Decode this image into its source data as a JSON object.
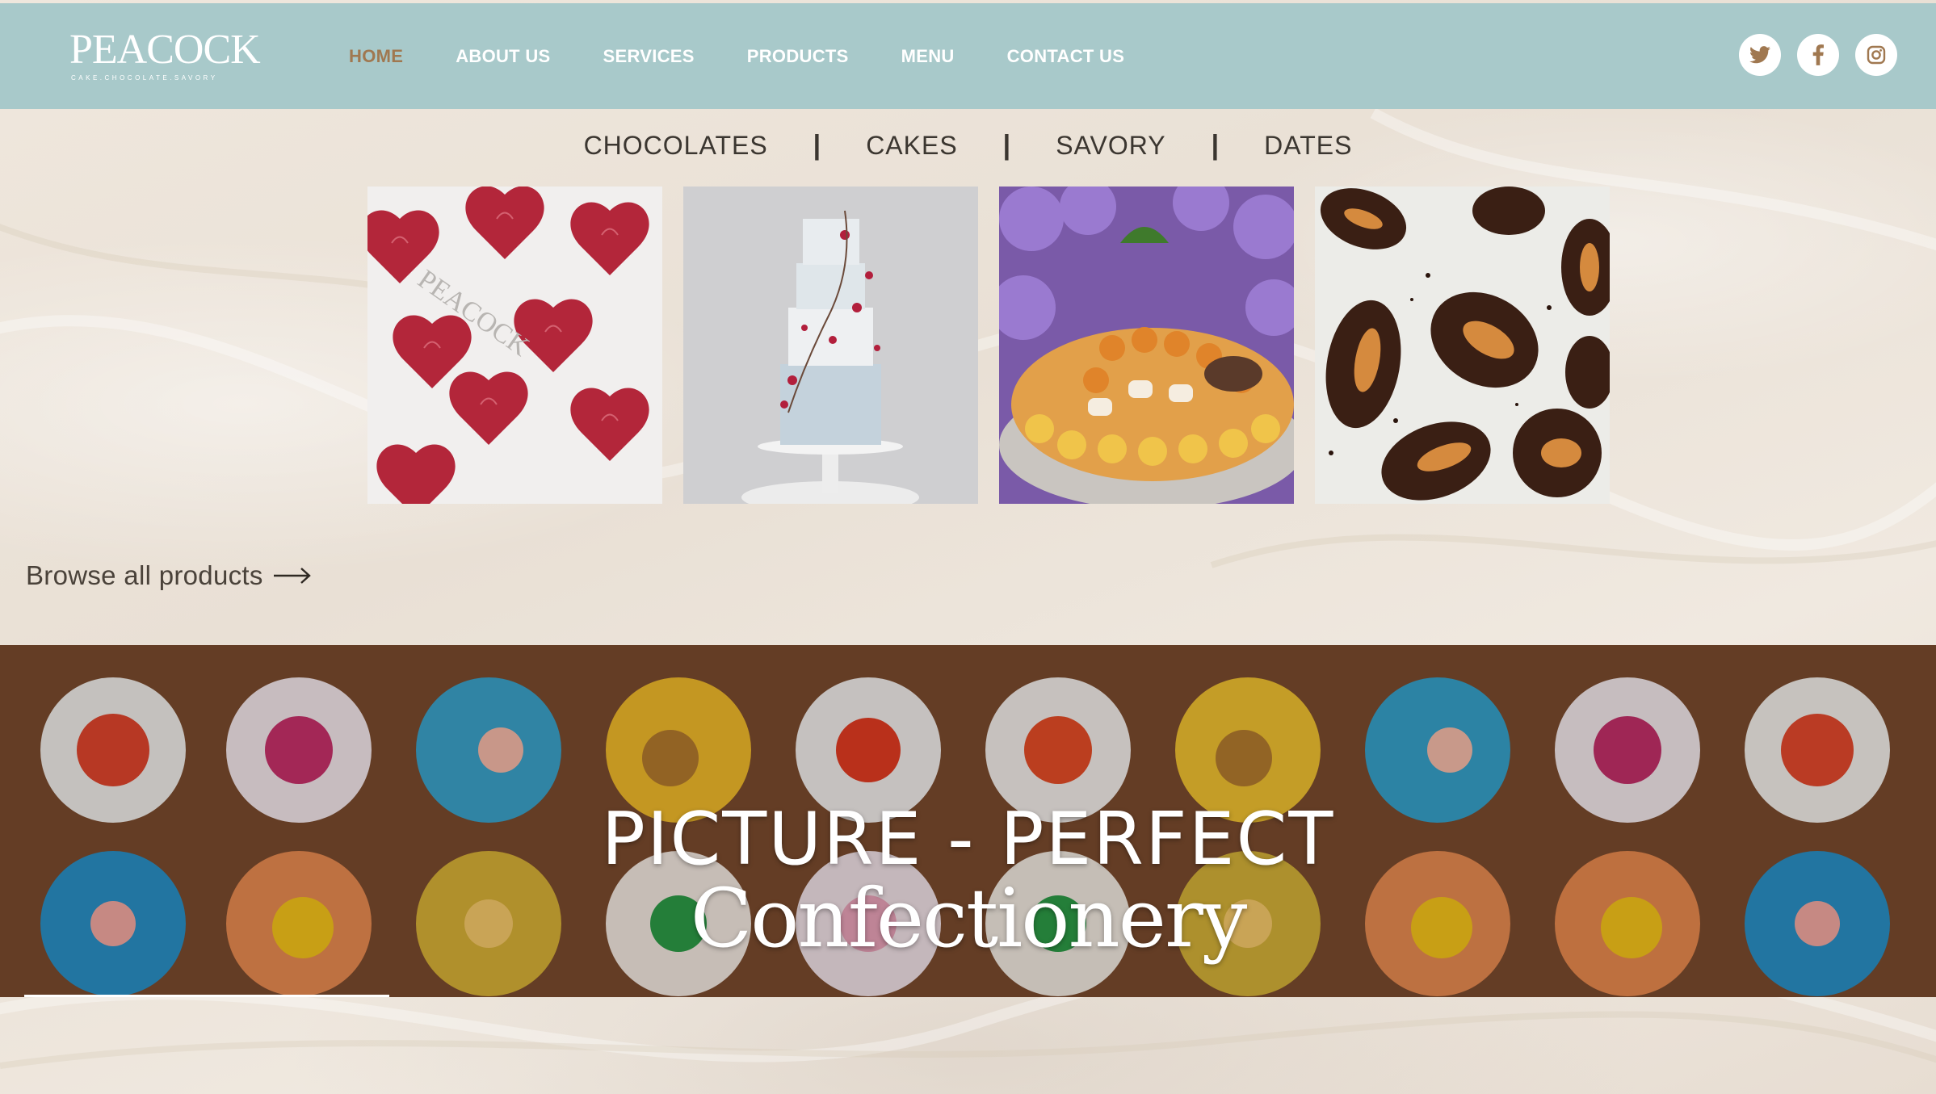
{
  "brand": {
    "logo_word": "PEACOCK",
    "logo_tagline": "CAKE.CHOCOLATE.SAVORY"
  },
  "nav": {
    "items": [
      {
        "label": "HOME",
        "active": true
      },
      {
        "label": "ABOUT US",
        "active": false
      },
      {
        "label": "SERVICES",
        "active": false
      },
      {
        "label": "PRODUCTS",
        "active": false
      },
      {
        "label": "MENU",
        "active": false
      },
      {
        "label": "CONTACT US",
        "active": false
      }
    ]
  },
  "social": [
    "twitter-icon",
    "facebook-icon",
    "instagram-icon"
  ],
  "categories": [
    "CHOCOLATES",
    "CAKES",
    "SAVORY",
    "DATES"
  ],
  "category_separator": "|",
  "products": [
    "chocolates-tile",
    "cakes-tile",
    "savory-tile",
    "dates-tile"
  ],
  "browse": {
    "label": "Browse all products"
  },
  "banner": {
    "title": "PICTURE - PERFECT",
    "subtitle": "Confectionery"
  },
  "colors": {
    "header_bg": "#a8c9ca",
    "active_nav": "#a07850",
    "page_bg": "#eee6dc",
    "text_dark": "#3b3630",
    "banner_bg": "#7a4a2c"
  }
}
